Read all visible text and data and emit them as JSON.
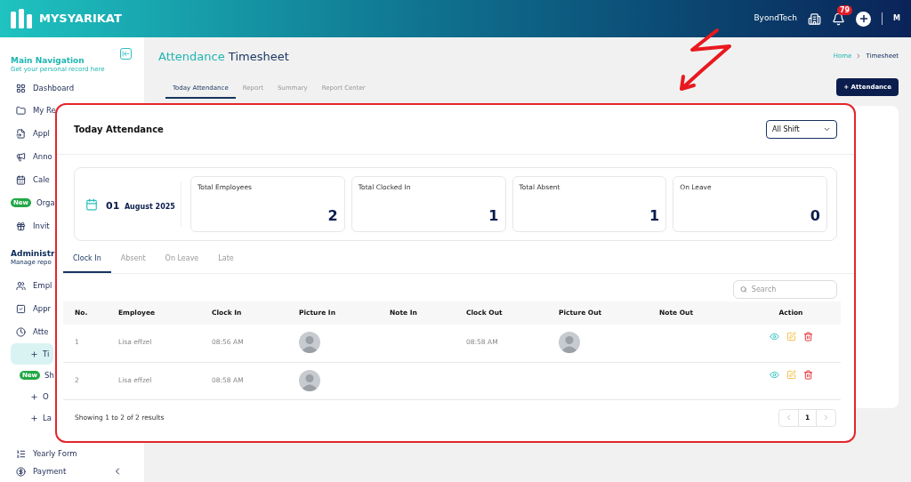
{
  "header": {
    "brand": "MYSYARIKAT",
    "company": "ByondTech",
    "notifications": "79",
    "user_initials": "M"
  },
  "sidebar": {
    "sections": [
      {
        "title": "Main Navigation",
        "subtitle": "Get your personal record here",
        "items": [
          {
            "label": "Dashboard",
            "selected": false
          },
          {
            "label": "My Re",
            "selected": false
          },
          {
            "label": "Appl",
            "selected": false
          },
          {
            "label": "Anno",
            "selected": false
          },
          {
            "label": "Cale",
            "selected": false
          },
          {
            "label": "Orga",
            "badge": "New",
            "selected": false
          },
          {
            "label": "Invit",
            "selected": false
          }
        ]
      },
      {
        "title": "Administr",
        "subtitle": "Manage repo",
        "items": [
          {
            "label": "Empl",
            "selected": false
          },
          {
            "label": "Appr",
            "selected": false
          },
          {
            "label": "Atte",
            "selected": false,
            "children": [
              {
                "label": "Ti",
                "selected": true
              },
              {
                "label": "Sh",
                "badge": "New",
                "selected": false
              },
              {
                "label": "O",
                "selected": false
              },
              {
                "label": "La",
                "selected": false
              }
            ]
          },
          {
            "label": "Yearly Form",
            "selected": false
          },
          {
            "label": "Payment",
            "selected": false
          }
        ]
      }
    ]
  },
  "page": {
    "title_part1": "Attendance",
    "title_part2": "Timesheet",
    "breadcrumb": [
      "Home",
      "Timesheet"
    ],
    "tabs": [
      {
        "label": "Today Attendance",
        "selected": true
      },
      {
        "label": "Report",
        "selected": false
      },
      {
        "label": "Summary",
        "selected": false
      },
      {
        "label": "Report Center",
        "selected": false
      }
    ],
    "add_button": "+ Attendance"
  },
  "zoom": {
    "title": "Today Attendance",
    "shift_select": "All Shift",
    "date_day": "01",
    "date_rest": "August 2025",
    "stats": [
      {
        "label": "Total Employees",
        "value": "2"
      },
      {
        "label": "Total Clocked In",
        "value": "1"
      },
      {
        "label": "Total Absent",
        "value": "1"
      },
      {
        "label": "On Leave",
        "value": "0"
      }
    ],
    "tabs": [
      {
        "label": "Clock In",
        "selected": true
      },
      {
        "label": "Absent",
        "selected": false
      },
      {
        "label": "On Leave",
        "selected": false
      },
      {
        "label": "Late",
        "selected": false
      }
    ],
    "search": {
      "placeholder": "Search"
    },
    "table": {
      "columns": [
        "No.",
        "Employee",
        "Clock In",
        "Picture In",
        "Note In",
        "Clock Out",
        "Picture Out",
        "Note Out",
        "Action"
      ],
      "rows": [
        {
          "no": "1",
          "employee": "Lisa effzel",
          "clock_in": "08:56 AM",
          "picture_in": true,
          "clock_out": "08:58 AM",
          "picture_out": true
        },
        {
          "no": "2",
          "employee": "Lisa effzel",
          "clock_in": "08:58 AM",
          "picture_in": true,
          "picture_out": false
        }
      ]
    },
    "footer": "Showing 1 to 2 of 2 results",
    "page": "1"
  }
}
